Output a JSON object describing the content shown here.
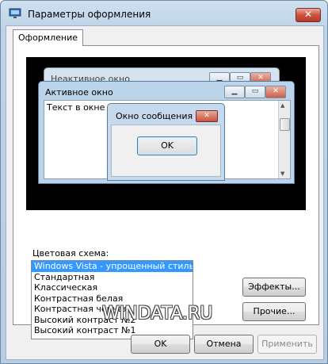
{
  "window": {
    "title": "Параметры оформления",
    "close_glyph": "✕"
  },
  "tabs": [
    {
      "label": "Оформление"
    }
  ],
  "preview": {
    "inactive_window_title": "Неактивное окно",
    "active_window_title": "Активное окно",
    "window_text": "Текст в окне",
    "message_box_title": "Окно сообщения",
    "message_box_ok": "OK",
    "minimize_glyph": "▁",
    "maximize_glyph": "▭",
    "close_glyph": "✕"
  },
  "color_scheme": {
    "label": "Цветовая схема:",
    "options": [
      "Windows Vista - упрощенный стиль",
      "Стандартная",
      "Классическая",
      "Контрастная белая",
      "Контрастная черная",
      "Высокий контраст №2",
      "Высокий контраст №1"
    ],
    "selected_index": 0
  },
  "buttons": {
    "effects": "Эффекты...",
    "other": "Прочие...",
    "ok": "OK",
    "cancel": "Отмена",
    "apply": "Применить"
  },
  "watermark": "WINDATA.RU",
  "colors": {
    "selection": "#3399ff",
    "close_red": "#c9533f",
    "frame": "#b6cde3"
  }
}
